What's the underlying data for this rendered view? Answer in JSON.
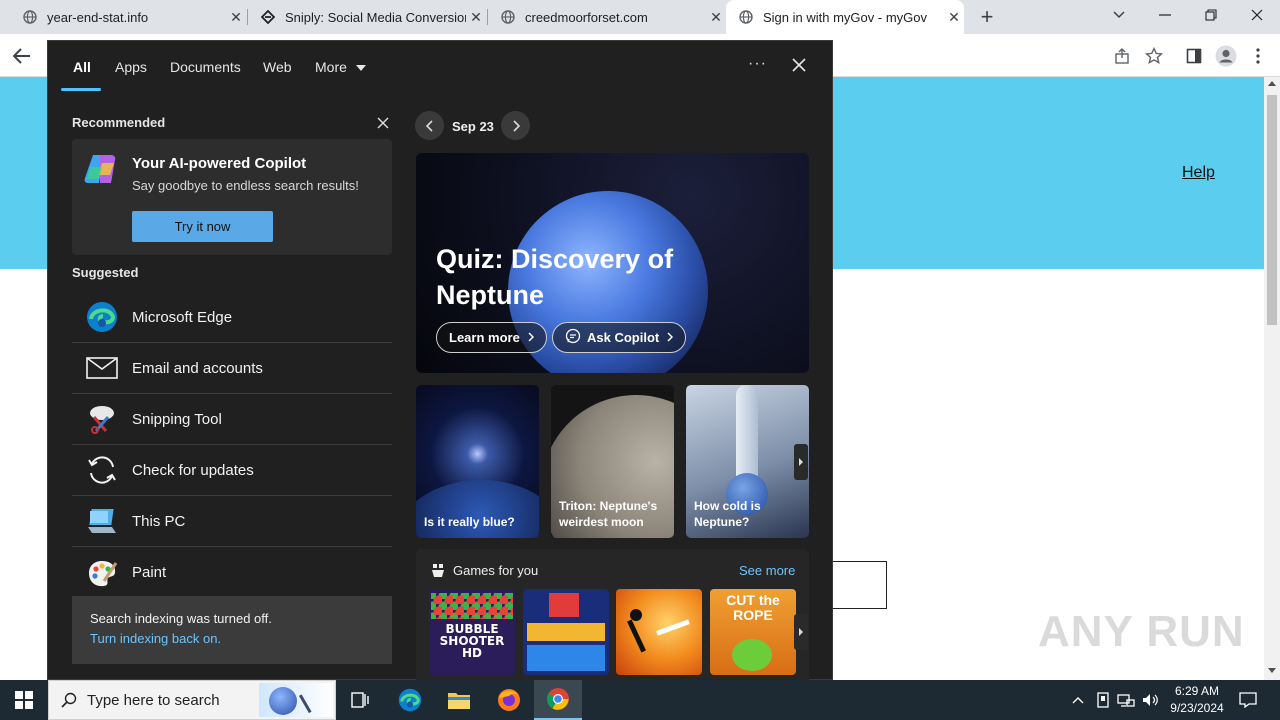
{
  "browser": {
    "tabs": [
      {
        "title": "year-end-stat.info"
      },
      {
        "title": "Sniply: Social Media Conversion"
      },
      {
        "title": "creedmoorforset.com"
      },
      {
        "title": "Sign in with myGov - myGov"
      }
    ],
    "new_tab_symbol": "+"
  },
  "page": {
    "help_link": "Help",
    "watermark": "ANY RUN"
  },
  "search_panel": {
    "filter_tabs": [
      "All",
      "Apps",
      "Documents",
      "Web",
      "More"
    ],
    "more_options": "···",
    "recommended_title": "Recommended",
    "copilot": {
      "title": "Your AI-powered Copilot",
      "subtitle": "Say goodbye to endless search results!",
      "button": "Try it now"
    },
    "suggested_title": "Suggested",
    "suggested": [
      {
        "label": "Microsoft Edge",
        "icon": "edge-icon"
      },
      {
        "label": "Email and accounts",
        "icon": "mail-icon"
      },
      {
        "label": "Snipping Tool",
        "icon": "snipping-tool-icon"
      },
      {
        "label": "Check for updates",
        "icon": "sync-icon"
      },
      {
        "label": "This PC",
        "icon": "computer-icon"
      },
      {
        "label": "Paint",
        "icon": "paint-icon"
      }
    ],
    "indexing": {
      "message": "Search indexing was turned off.",
      "link": "Turn indexing back on."
    },
    "date": "Sep 23",
    "hero": {
      "title": "Quiz: Discovery of Neptune",
      "learn_more": "Learn more",
      "ask_copilot": "Ask Copilot"
    },
    "thumbnails": [
      {
        "caption": "Is it really blue?"
      },
      {
        "caption": "Triton: Neptune's weirdest moon"
      },
      {
        "caption": "How cold is Neptune?"
      }
    ],
    "games": {
      "title": "Games for you",
      "see_more": "See more",
      "items": [
        {
          "name": "BUBBLE SHOOTER HD"
        },
        {
          "name": "Blocks"
        },
        {
          "name": "Stickman"
        },
        {
          "name": "CUT the ROPE"
        }
      ]
    }
  },
  "taskbar": {
    "search_placeholder": "Type here to search",
    "time": "6:29 AM",
    "date": "9/23/2024"
  },
  "colors": {
    "banner": "#5bcef0",
    "accent": "#4cc2ff",
    "panel_bg": "#202020",
    "try_button": "#5aa9e6"
  }
}
